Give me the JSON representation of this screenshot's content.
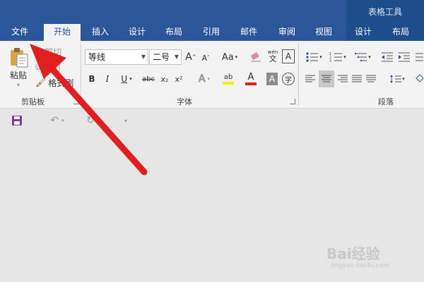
{
  "context_tab_group": "表格工具",
  "tabs": [
    "文件",
    "开始",
    "插入",
    "设计",
    "布局",
    "引用",
    "邮件",
    "审阅",
    "视图",
    "设计",
    "布局"
  ],
  "clipboard": {
    "paste": "粘贴",
    "cut": "剪切",
    "copy": "复制",
    "format_painter": "格式刷",
    "group_label": "剪贴板"
  },
  "font": {
    "font_name": "等线",
    "font_size": "二号",
    "grow": "A",
    "shrink": "A",
    "case": "Aa",
    "phonetic": "wén",
    "phonetic_char": "文",
    "border_char": "A",
    "bold": "B",
    "italic": "I",
    "underline": "U",
    "strike": "abc",
    "subscript": "x₂",
    "superscript": "x²",
    "effects": "A",
    "highlight": "ab",
    "font_color": "A",
    "shading": "A",
    "enclose": "字",
    "group_label": "字体"
  },
  "paragraph": {
    "group_label": "段落"
  },
  "watermark": {
    "brand": "Bai经验",
    "sub": "jingyan.baidu.com"
  },
  "colors": {
    "titlebar": "#2b579a",
    "arrow": "#e02020",
    "highlight_bar": "#ffee00",
    "font_color_bar": "#e02020"
  }
}
